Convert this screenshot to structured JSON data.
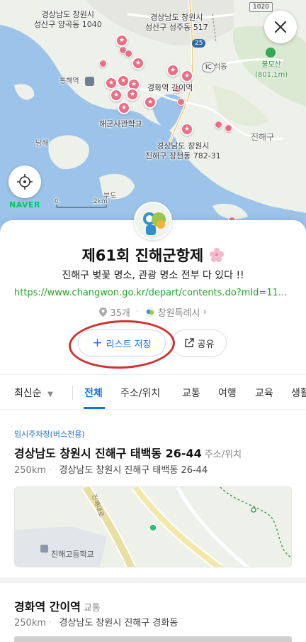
{
  "map": {
    "labels": {
      "yanggok": "경상남도 창원시\n성산구 양곡동 1040",
      "seongju": "경상남도 창원시\n성산구 성주동 517",
      "tonghae": "통해역",
      "gyeonghwa": "경화역 간이역",
      "naval": "해군사관학교",
      "namhae": "남해",
      "jangcheon": "경상남도 창원시\n진해구 장천동 782-31",
      "jinhaegu": "진해구",
      "bulmosan": "불모산\n(801.1m)",
      "seokdong": "석동",
      "budo": "부도"
    },
    "road_numbers": [
      "25",
      "1020"
    ],
    "ic_label": "IC",
    "scale_zero": "0",
    "scale_label": "2km",
    "brand": "NAVER",
    "pin_color": "#ea6e86",
    "water_color": "#9cc4ea"
  },
  "sheet": {
    "title": "제61회 진해군항제",
    "subtitle": "진해구 벚꽃 명소, 관광 명소 전부 다 있다 !!",
    "url": "https://www.changwon.go.kr/depart/contents.do?mId=11...",
    "count": "35개",
    "owner": "창원특례시",
    "save_label": "리스트 저장",
    "share_label": "공유",
    "accent_color": "#1a6fd8"
  },
  "tabs": {
    "sort_label": "최신순",
    "items": [
      "전체",
      "주소/위치",
      "교통",
      "여행",
      "교육",
      "생활"
    ],
    "active": "전체"
  },
  "list": {
    "item1": {
      "badge": "임시주차장(버스전용)",
      "title": "경상남도 창원시 진해구 태백동 26-44",
      "category": "주소/위치",
      "distance": "250km",
      "address": "경상남도 창원시 진해구 태백동 26-44",
      "minimap_road": "진해대로",
      "minimap_school": "진해고등학교"
    },
    "item2": {
      "title": "경화역 간이역",
      "category": "교통",
      "distance": "250km",
      "address": "경상남도 창원시 진해구 경화동"
    }
  }
}
